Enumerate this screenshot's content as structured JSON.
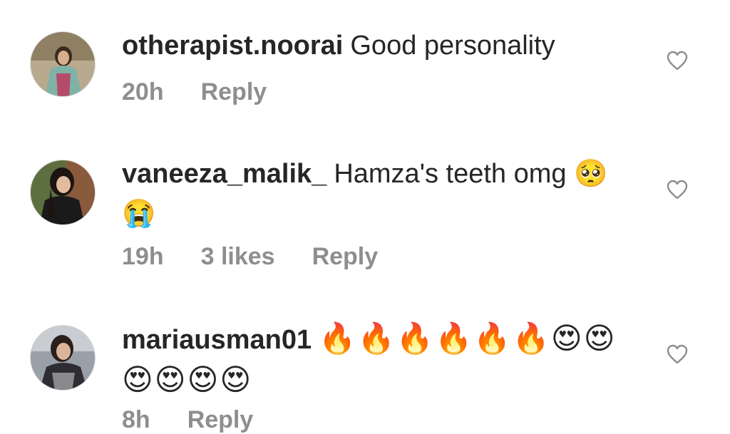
{
  "comments": [
    {
      "username": "otherapist.noorai",
      "text": "Good personality",
      "time": "20h",
      "likes": "",
      "reply_label": "Reply"
    },
    {
      "username": "vaneeza_malik_",
      "text": "Hamza's teeth omg 🥺😭",
      "time": "19h",
      "likes": "3 likes",
      "reply_label": "Reply"
    },
    {
      "username": "mariausman01",
      "text": "🔥🔥🔥🔥🔥🔥😍😍😍😍😍😍",
      "time": "8h",
      "likes": "",
      "reply_label": "Reply"
    }
  ],
  "icons": {
    "like": "heart-outline-icon"
  },
  "colors": {
    "text": "#262626",
    "secondary": "#8e8e8e",
    "avatar_border": "#dbdbdb"
  }
}
